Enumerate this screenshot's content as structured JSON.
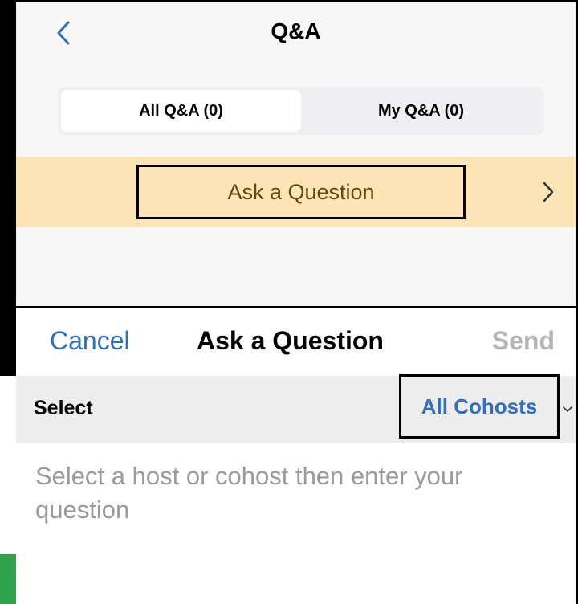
{
  "header": {
    "title": "Q&A",
    "back_icon": "chevron-left-icon"
  },
  "tabs": [
    {
      "label": "All Q&A (0)",
      "selected": true
    },
    {
      "label": "My Q&A (0)",
      "selected": false
    }
  ],
  "ask_row": {
    "label": "Ask a Question",
    "chevron_icon": "chevron-right-icon"
  },
  "sheet": {
    "cancel_label": "Cancel",
    "title": "Ask a Question",
    "send_label": "Send",
    "select_label": "Select",
    "recipient_value": "All Cohosts",
    "recipient_caret_icon": "chevron-down-icon",
    "question_value": "",
    "question_placeholder": "Select a host or cohost then enter your question"
  },
  "colors": {
    "accent_blue": "#2f6fbe",
    "ask_band": "#fde5b7",
    "ask_text": "#6b4310",
    "send_disabled": "#b5b5b9",
    "select_row_bg": "#ededee",
    "placeholder": "#9a9a9e"
  }
}
